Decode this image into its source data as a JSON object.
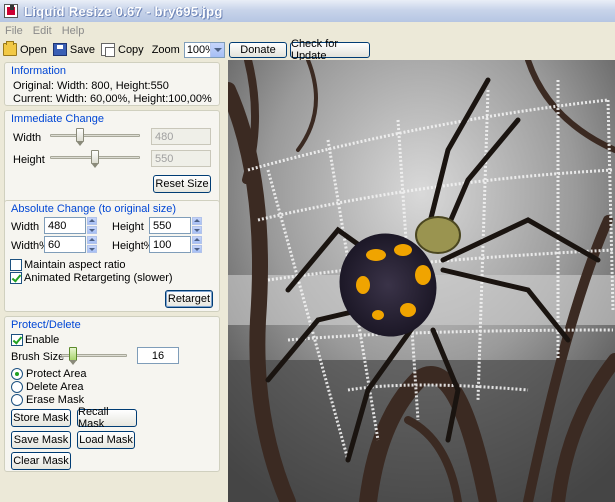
{
  "window": {
    "title": "Liquid Resize 0.67 - bry695.jpg"
  },
  "menu": [
    "File",
    "Edit",
    "Help"
  ],
  "toolbar": {
    "open": "Open",
    "save": "Save",
    "copy": "Copy",
    "zoom_label": "Zoom",
    "zoom_value": "100%"
  },
  "top_buttons": {
    "donate": "Donate",
    "check_update": "Check for Update"
  },
  "information": {
    "title": "Information",
    "original": "Original: Width: 800, Height:550",
    "current": "Current: Width: 60,00%, Height:100,00%"
  },
  "immediate": {
    "title": "Immediate Change",
    "width_label": "Width",
    "width_value": "480",
    "height_label": "Height",
    "height_value": "550",
    "reset": "Reset Size"
  },
  "absolute": {
    "title": "Absolute Change (to original size)",
    "width_label": "Width",
    "width_value": "480",
    "height_label": "Height",
    "height_value": "550",
    "widthpct_label": "Width%",
    "widthpct_value": "60",
    "heightpct_label": "Height%",
    "heightpct_value": "100",
    "maintain": "Maintain aspect ratio",
    "animated": "Animated Retargeting (slower)",
    "retarget": "Retarget"
  },
  "protect": {
    "title": "Protect/Delete",
    "enable": "Enable",
    "brush_label": "Brush Size",
    "brush_value": "16",
    "protect_area": "Protect Area",
    "delete_area": "Delete Area",
    "erase_mask": "Erase Mask",
    "store_mask": "Store Mask",
    "recall_mask": "Recall Mask",
    "save_mask": "Save Mask",
    "load_mask": "Load Mask",
    "clear_mask": "Clear Mask"
  },
  "colors": {
    "group_title": "#0046d5",
    "window_bg": "#ece9d8"
  }
}
